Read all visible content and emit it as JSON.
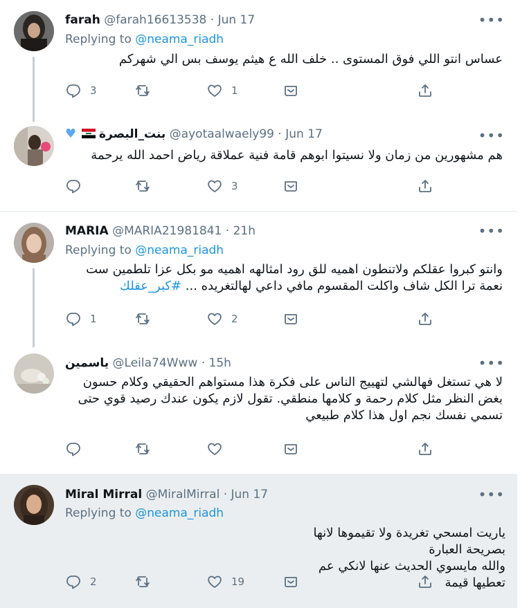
{
  "tweets": [
    {
      "name": "farah",
      "handle": "@farah16613538",
      "sep": "·",
      "time": "Jun 17",
      "replying_prefix": "Replying to ",
      "replying_to": "@neama_riadh",
      "text": "عساس انتو اللي فوق المستوى .. خلف الله ع هيثم يوسف بس الي شهركم",
      "replies": "3",
      "retweets": "",
      "likes": "1"
    },
    {
      "name": "بنت_البصرة",
      "handle": "@ayotaalwaely99",
      "sep": "·",
      "time": "Jun 17",
      "text": "هم مشهورين من زمان ولا نسيتوا ابوهم قامة فنية عملاقة رياض احمد الله يرحمة",
      "replies": "",
      "retweets": "",
      "likes": "3"
    },
    {
      "name": "MARIA",
      "handle": "@MARIA21981841",
      "sep": "·",
      "time": "21h",
      "replying_prefix": "Replying to ",
      "replying_to": "@neama_riadh",
      "text_line1": "وانتو كبروا عقلكم ولاتنطون اهميه للق رود امثالهه اهميه مو بكل عزا تلطمين ست",
      "text_line2": "نعمة ترا الكل شاف واكلت المقسوم مافي داعي لهالتغريده ...",
      "hashtag": "#كبر_عقلك",
      "replies": "1",
      "retweets": "",
      "likes": "2"
    },
    {
      "name": "ياسمين",
      "handle": "@Leila74Www",
      "sep": "·",
      "time": "15h",
      "text": "لا هي تستغل فهالشي لتهييج الناس على فكرة هذا مستواهم الحقيقي وكلام حسون بغض النظر مثل كلام رحمة و كلامها منطقي. تقول لازم يكون عندك رصيد قوي حتى تسمي نفسك نجم اول هذا كلام طبيعي",
      "replies": "",
      "retweets": "",
      "likes": ""
    },
    {
      "name": "Miral Mirral",
      "handle": "@MiralMirral",
      "sep": "·",
      "time": "Jun 17",
      "replying_prefix": "Replying to ",
      "replying_to": "@neama_riadh",
      "text_line1": "ياريت امسحي تغريدة ولا تقيموها لانها بصريحة العبارة",
      "text_line2": "والله مايسوي  الحديث عنها لانكي عم تعطيها قيمة",
      "replies": "2",
      "retweets": "",
      "likes": "19"
    }
  ],
  "more_glyph": "•••",
  "colors": {
    "link": "#1b95e0",
    "muted": "#5b7083",
    "highlight_bg": "#ebeef0",
    "separator": "#e6ecf0"
  },
  "icons": [
    "reply-icon",
    "retweet-icon",
    "like-icon",
    "share-dm-icon",
    "share-icon",
    "more-icon",
    "iraq-flag-icon",
    "blue-heart-icon"
  ]
}
